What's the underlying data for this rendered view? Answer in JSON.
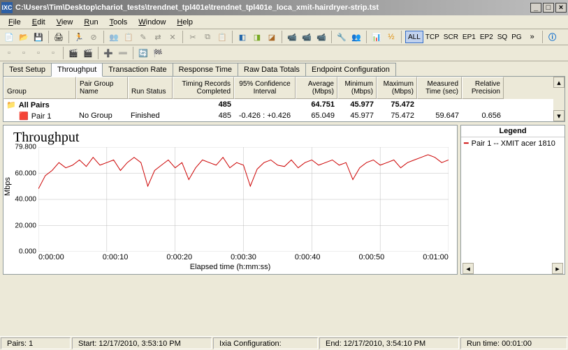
{
  "window": {
    "title": "C:\\Users\\Tim\\Desktop\\chariot_tests\\trendnet_tpl401e\\trendnet_tpl401e_loca_xmit-hairdryer-strip.tst",
    "icon_text": "IXC"
  },
  "menu": [
    "File",
    "Edit",
    "View",
    "Run",
    "Tools",
    "Window",
    "Help"
  ],
  "toolbar_text_buttons": [
    "ALL",
    "TCP",
    "SCR",
    "EP1",
    "EP2",
    "SQ",
    "PG"
  ],
  "tabs": [
    "Test Setup",
    "Throughput",
    "Transaction Rate",
    "Response Time",
    "Raw Data Totals",
    "Endpoint Configuration"
  ],
  "active_tab": 1,
  "grid": {
    "headers": [
      "Group",
      "Pair Group Name",
      "Run Status",
      "Timing Records Completed",
      "95% Confidence Interval",
      "Average (Mbps)",
      "Minimum (Mbps)",
      "Maximum (Mbps)",
      "Measured Time (sec)",
      "Relative Precision"
    ],
    "widths": [
      104,
      74,
      64,
      88,
      88,
      60,
      56,
      58,
      64,
      60
    ],
    "rows": [
      {
        "icon": "folder",
        "indent": 0,
        "bold": true,
        "cells": [
          "All Pairs",
          "",
          "",
          "485",
          "",
          "64.751",
          "45.977",
          "75.472",
          "",
          ""
        ]
      },
      {
        "icon": "pair",
        "indent": 1,
        "bold": false,
        "cells": [
          "Pair 1",
          "No Group",
          "Finished",
          "485",
          "-0.426 : +0.426",
          "65.049",
          "45.977",
          "75.472",
          "59.647",
          "0.656"
        ]
      }
    ]
  },
  "chart": {
    "title": "Throughput",
    "ylabel": "Mbps",
    "xlabel": "Elapsed time (h:mm:ss)",
    "yticks": [
      "79.800",
      "60.000",
      "40.000",
      "20.000",
      "0.000"
    ],
    "xticks": [
      "0:00:00",
      "0:00:10",
      "0:00:20",
      "0:00:30",
      "0:00:40",
      "0:00:50",
      "0:01:00"
    ]
  },
  "legend": {
    "title": "Legend",
    "items": [
      {
        "color": "#c00",
        "label": "Pair 1 -- XMIT acer 1810"
      }
    ]
  },
  "status": {
    "pairs": "Pairs: 1",
    "start": "Start: 12/17/2010, 3:53:10 PM",
    "ixia": "Ixia Configuration:",
    "end": "End: 12/17/2010, 3:54:10 PM",
    "runtime": "Run time: 00:01:00"
  },
  "chart_data": {
    "type": "line",
    "title": "Throughput",
    "xlabel": "Elapsed time (h:mm:ss)",
    "ylabel": "Mbps",
    "ylim": [
      0,
      79.8
    ],
    "x_seconds": [
      0,
      1,
      2,
      3,
      4,
      5,
      6,
      7,
      8,
      9,
      10,
      11,
      12,
      13,
      14,
      15,
      16,
      17,
      18,
      19,
      20,
      21,
      22,
      23,
      24,
      25,
      26,
      27,
      28,
      29,
      30,
      31,
      32,
      33,
      34,
      35,
      36,
      37,
      38,
      39,
      40,
      41,
      42,
      43,
      44,
      45,
      46,
      47,
      48,
      49,
      50,
      51,
      52,
      53,
      54,
      55,
      56,
      57,
      58,
      59,
      60
    ],
    "series": [
      {
        "name": "Pair 1 -- XMIT acer 1810",
        "color": "#c00",
        "values": [
          48,
          58,
          62,
          68,
          64,
          66,
          70,
          65,
          72,
          66,
          68,
          70,
          62,
          68,
          72,
          68,
          50,
          62,
          66,
          70,
          64,
          68,
          55,
          64,
          70,
          68,
          66,
          72,
          64,
          68,
          66,
          50,
          63,
          68,
          70,
          66,
          65,
          70,
          64,
          68,
          70,
          66,
          68,
          70,
          66,
          68,
          55,
          64,
          68,
          70,
          66,
          68,
          70,
          64,
          68,
          70,
          72,
          74,
          72,
          68,
          70
        ]
      }
    ]
  }
}
